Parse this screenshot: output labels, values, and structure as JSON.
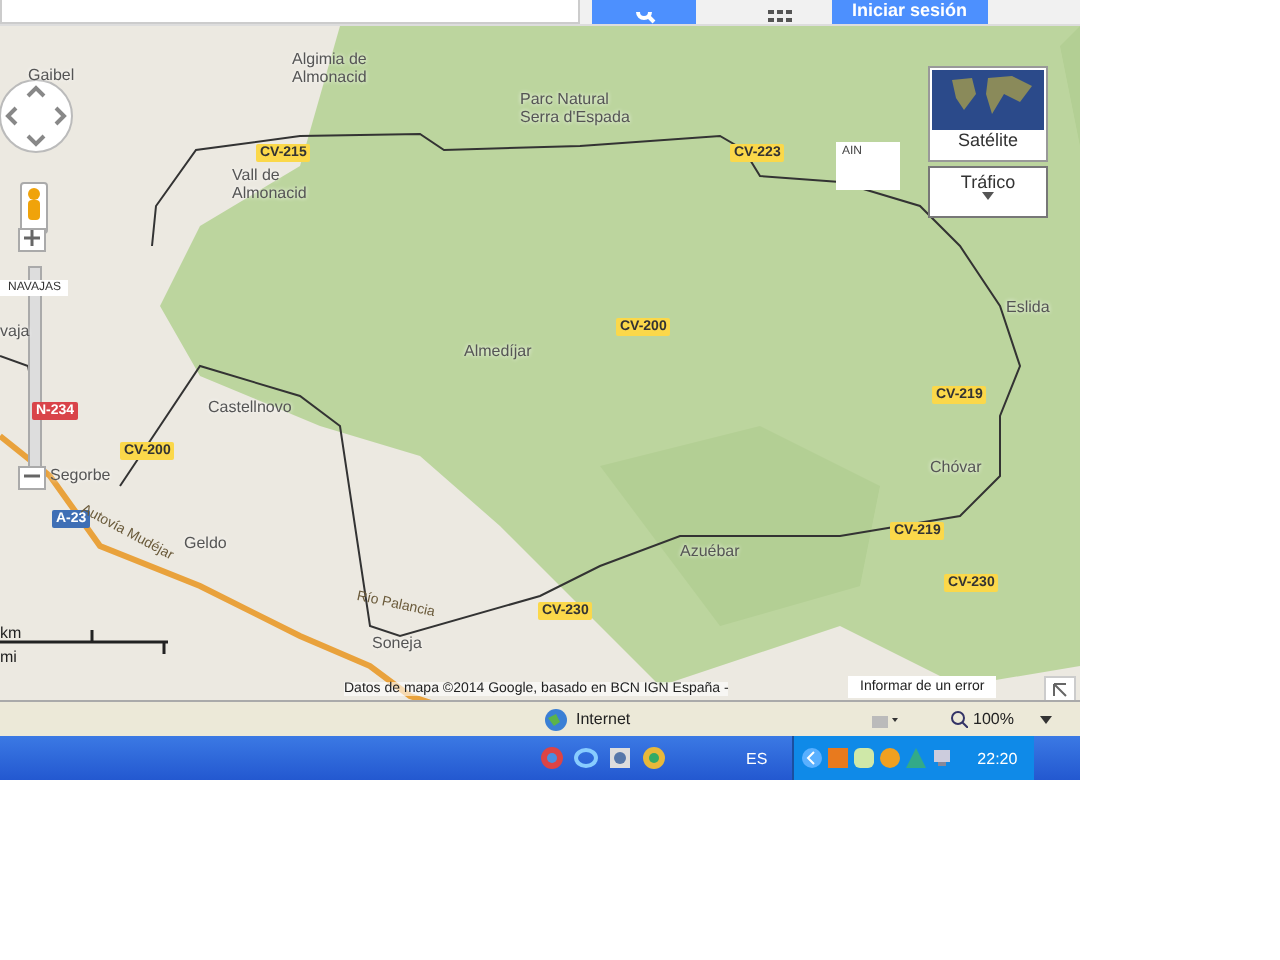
{
  "header": {
    "login_button": "Iniciar sesión"
  },
  "map": {
    "place_labels": [
      "Gaibel",
      "Algimia de Almonacid",
      "Vall de Almonacid",
      "Parc Natural Serra d'Espada",
      "Almedíjar",
      "Castellnovo",
      "Segorbe",
      "Geldo",
      "Soneja",
      "Azuébar",
      "Chóvar",
      "Eslida",
      "vaja"
    ],
    "road_shields": [
      {
        "label": "CV-215",
        "kind": "regional"
      },
      {
        "label": "CV-223",
        "kind": "regional"
      },
      {
        "label": "CV-200",
        "kind": "regional"
      },
      {
        "label": "CV-219",
        "kind": "regional"
      },
      {
        "label": "CV-219",
        "kind": "regional"
      },
      {
        "label": "CV-230",
        "kind": "regional"
      },
      {
        "label": "CV-230",
        "kind": "regional"
      },
      {
        "label": "CV-200",
        "kind": "regional"
      },
      {
        "label": "N-234",
        "kind": "national"
      },
      {
        "label": "A-23",
        "kind": "motorway"
      }
    ],
    "road_names": [
      "Autovía Mudéjar",
      "Río Palancia"
    ],
    "poi_label": "AIN",
    "zoom_tooltip": "NAVAJAS",
    "map_type": {
      "satellite": "Satélite",
      "traffic": "Tráfico"
    },
    "scale": [
      "km",
      "mi"
    ],
    "attribution": "Datos de mapa ©2014 Google, basado en BCN IGN España -",
    "report_link": "Informar de un error"
  },
  "status_bar": {
    "zone": "Internet",
    "zoom": "100%"
  },
  "taskbar": {
    "language": "ES",
    "clock": "22:20"
  }
}
